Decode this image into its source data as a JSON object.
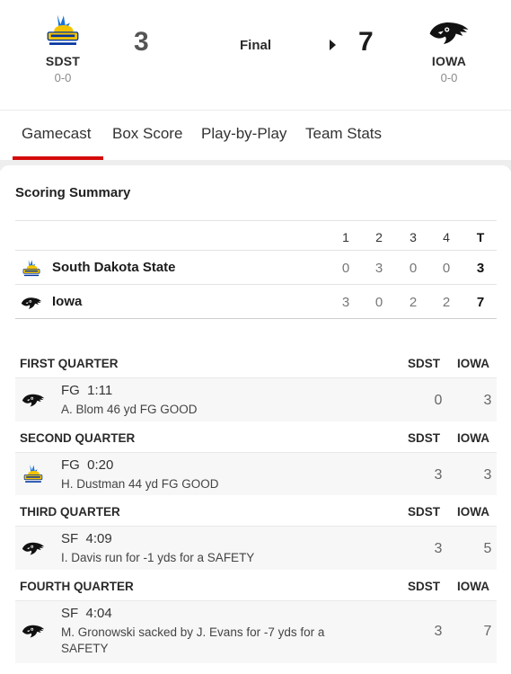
{
  "header": {
    "away": {
      "abbr": "SDST",
      "record": "0-0",
      "score": "3",
      "logo": "jackrabbits-logo"
    },
    "home": {
      "abbr": "IOWA",
      "record": "0-0",
      "score": "7",
      "logo": "hawkeye-logo"
    },
    "status": "Final",
    "winner_indicator": "triangle-right"
  },
  "tabs": [
    {
      "label": "Gamecast",
      "active": true
    },
    {
      "label": "Box Score"
    },
    {
      "label": "Play-by-Play"
    },
    {
      "label": "Team Stats"
    }
  ],
  "scoring_summary": {
    "title": "Scoring Summary",
    "columns": [
      "1",
      "2",
      "3",
      "4",
      "T"
    ],
    "rows": [
      {
        "team": "South Dakota State",
        "quarters": [
          "0",
          "3",
          "0",
          "0"
        ],
        "total": "3"
      },
      {
        "team": "Iowa",
        "quarters": [
          "3",
          "0",
          "2",
          "2"
        ],
        "total": "7"
      }
    ]
  },
  "quarters": [
    {
      "title": "FIRST QUARTER",
      "col_away": "SDST",
      "col_home": "IOWA",
      "plays": [
        {
          "team": "iowa",
          "type": "FG  1:11",
          "desc": "A. Blom 46 yd FG GOOD",
          "away": "0",
          "home": "3"
        }
      ]
    },
    {
      "title": "SECOND QUARTER",
      "col_away": "SDST",
      "col_home": "IOWA",
      "plays": [
        {
          "team": "sdst",
          "type": "FG  0:20",
          "desc": "H. Dustman 44 yd FG GOOD",
          "away": "3",
          "home": "3"
        }
      ]
    },
    {
      "title": "THIRD QUARTER",
      "col_away": "SDST",
      "col_home": "IOWA",
      "plays": [
        {
          "team": "iowa",
          "type": "SF  4:09",
          "desc": "I. Davis run for -1 yds for a SAFETY",
          "away": "3",
          "home": "5"
        }
      ]
    },
    {
      "title": "FOURTH QUARTER",
      "col_away": "SDST",
      "col_home": "IOWA",
      "plays": [
        {
          "team": "iowa",
          "type": "SF  4:04",
          "desc": "M. Gronowski sacked by J. Evans for -7 yds for a SAFETY",
          "away": "3",
          "home": "7"
        }
      ]
    }
  ],
  "colors": {
    "accent": "#d50a0a",
    "sdst_yellow": "#f5c400",
    "sdst_blue": "#0033a0"
  }
}
